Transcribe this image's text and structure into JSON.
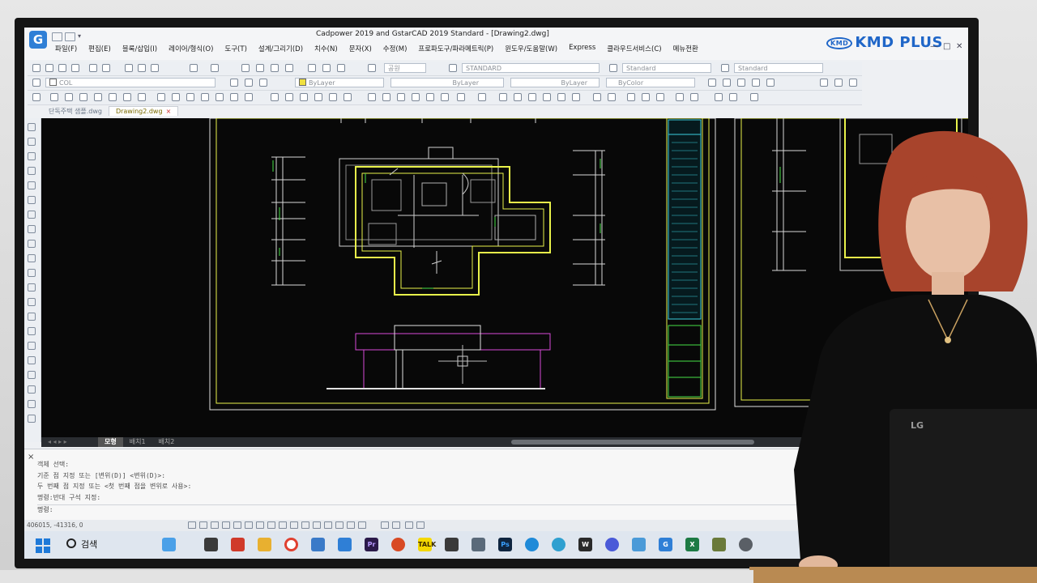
{
  "window": {
    "title": "Cadpower 2019  and GstarCAD 2019 Standard - [Drawing2.dwg]",
    "logo": "G"
  },
  "watermark": {
    "badge": "KMD",
    "text": "KMD PLUS"
  },
  "menu": [
    "파일(F)",
    "편집(E)",
    "블록/삽입(I)",
    "레이어/형식(O)",
    "도구(T)",
    "설계/그리기(D)",
    "치수(N)",
    "문자(X)",
    "수정(M)",
    "프로파도구/파라메트릭(P)",
    "윈도우/도움말(W)",
    "Express",
    "클라우드서비스(C)",
    "메뉴전환"
  ],
  "toolbar": {
    "text_style": "STANDARD",
    "dim_style": "Standard",
    "table_style": "Standard",
    "layer": "COL",
    "color": "ByLayer",
    "linetype": "ByLayer",
    "lineweight": "ByLayer",
    "plotstyle": "ByColor",
    "current_block": "공원"
  },
  "tabs": {
    "doc1": "단독주택 샘플.dwg",
    "doc2": "Drawing2.dwg",
    "close": "×"
  },
  "layout_tabs": [
    "모형",
    "배치1",
    "배치2"
  ],
  "command": {
    "lines": [
      "객체 선택:",
      "기준 점 지정 또는 [변위(D)] <변위(D)>:",
      "두 번째 점 지정 또는 <첫 번째 점을 변위로 사용>:",
      "명령:반대 구석 지정:"
    ],
    "prompt": "명령:",
    "close": "×"
  },
  "status": {
    "coords": "406015, -41316, 0"
  },
  "taskbar": {
    "search_label": "검색"
  },
  "laptop_brand": "LG",
  "colors": {
    "drawing_yellow": "#e8f24a",
    "drawing_magenta": "#d84ad8",
    "drawing_green": "#46e046",
    "accent_blue": "#1f66c8"
  }
}
